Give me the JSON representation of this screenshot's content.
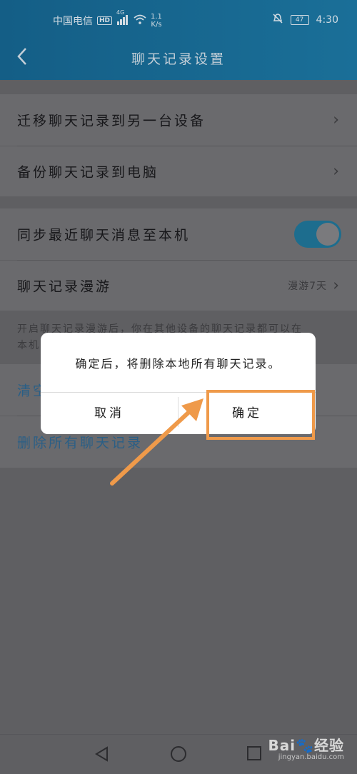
{
  "status_bar": {
    "carrier": "中国电信",
    "hd": "HD",
    "network": "4G",
    "speed_value": "1.1",
    "speed_unit": "K/s",
    "battery": "47",
    "time": "4:30"
  },
  "header": {
    "title": "聊天记录设置"
  },
  "settings": {
    "migrate_label": "迁移聊天记录到另一台设备",
    "backup_label": "备份聊天记录到电脑",
    "sync_label": "同步最近聊天消息至本机",
    "sync_enabled": true,
    "roaming_label": "聊天记录漫游",
    "roaming_value": "漫游7天",
    "tip_line1": "开启聊天记录漫游后，你在其他设备的聊天记录都可以在",
    "tip_line2": "本机",
    "clear_label": "清空",
    "delete_all_label": "删除所有聊天记录"
  },
  "dialog": {
    "message": "确定后，将删除本地所有聊天记录。",
    "cancel_label": "取消",
    "confirm_label": "确定"
  },
  "watermark": {
    "brand": "Bai",
    "brand_suffix": "经验",
    "site": "jingyan.baidu.com"
  },
  "colors": {
    "header_bg": "#145e86",
    "overlay": "#5f5f62",
    "annotation": "#ef9a4a",
    "toggle_on": "#1d6d8e"
  }
}
